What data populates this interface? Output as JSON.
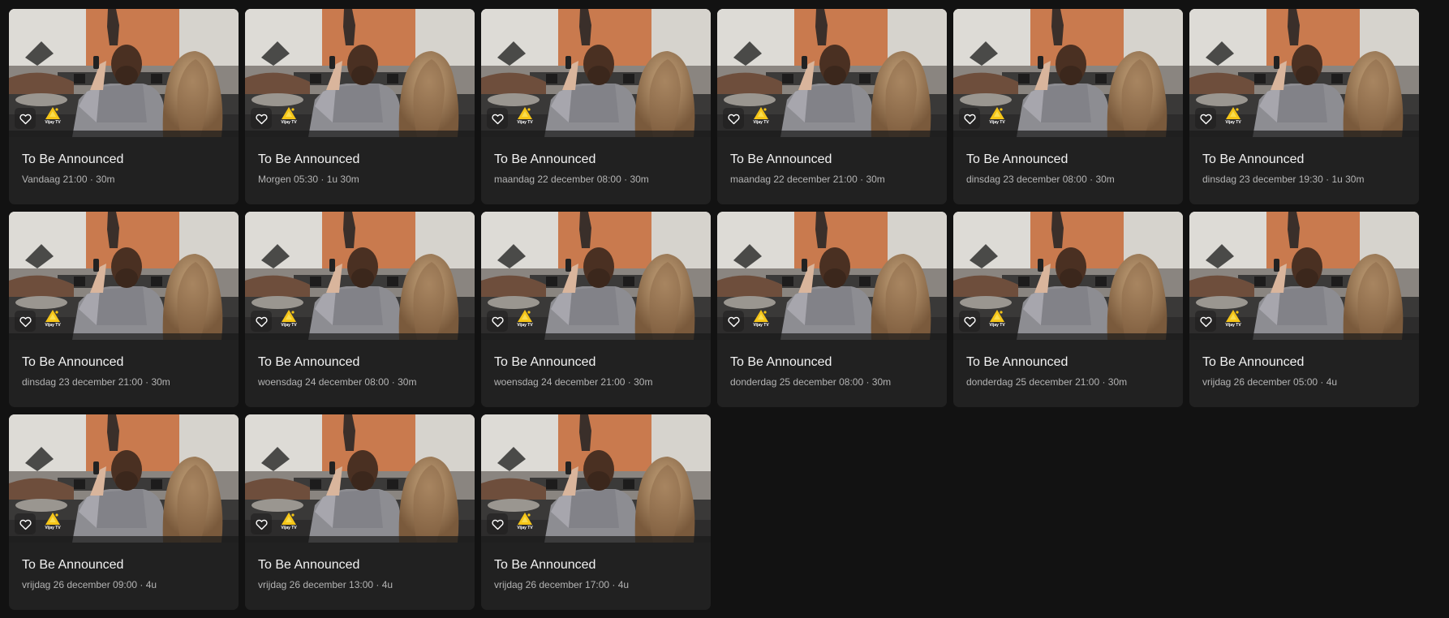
{
  "program_grid": {
    "items": [
      {
        "title": "To Be Announced",
        "meta": "Vandaag 21:00 · 30m",
        "channel": "Vijay TV"
      },
      {
        "title": "To Be Announced",
        "meta": "Morgen 05:30 · 1u 30m",
        "channel": "Vijay TV"
      },
      {
        "title": "To Be Announced",
        "meta": "maandag 22 december 08:00 · 30m",
        "channel": "Vijay TV"
      },
      {
        "title": "To Be Announced",
        "meta": "maandag 22 december 21:00 · 30m",
        "channel": "Vijay TV"
      },
      {
        "title": "To Be Announced",
        "meta": "dinsdag 23 december 08:00 · 30m",
        "channel": "Vijay TV"
      },
      {
        "title": "To Be Announced",
        "meta": "dinsdag 23 december 19:30 · 1u 30m",
        "channel": "Vijay TV"
      },
      {
        "title": "To Be Announced",
        "meta": "dinsdag 23 december 21:00 · 30m",
        "channel": "Vijay TV"
      },
      {
        "title": "To Be Announced",
        "meta": "woensdag 24 december 08:00 · 30m",
        "channel": "Vijay TV"
      },
      {
        "title": "To Be Announced",
        "meta": "woensdag 24 december 21:00 · 30m",
        "channel": "Vijay TV"
      },
      {
        "title": "To Be Announced",
        "meta": "donderdag 25 december 08:00 · 30m",
        "channel": "Vijay TV"
      },
      {
        "title": "To Be Announced",
        "meta": "donderdag 25 december 21:00 · 30m",
        "channel": "Vijay TV"
      },
      {
        "title": "To Be Announced",
        "meta": "vrijdag 26 december 05:00 · 4u",
        "channel": "Vijay TV"
      },
      {
        "title": "To Be Announced",
        "meta": "vrijdag 26 december 09:00 · 4u",
        "channel": "Vijay TV"
      },
      {
        "title": "To Be Announced",
        "meta": "vrijdag 26 december 13:00 · 4u",
        "channel": "Vijay TV"
      },
      {
        "title": "To Be Announced",
        "meta": "vrijdag 26 december 17:00 · 4u",
        "channel": "Vijay TV"
      }
    ]
  },
  "icons": {
    "favorite": "heart-outline-icon",
    "channel_logo": "vijay-tv-logo-icon"
  },
  "colors": {
    "background": "#121212",
    "card": "#212121",
    "title_text": "#f2f2f2",
    "meta_text": "#b4b4b4",
    "logo_yellow": "#f5c518"
  }
}
